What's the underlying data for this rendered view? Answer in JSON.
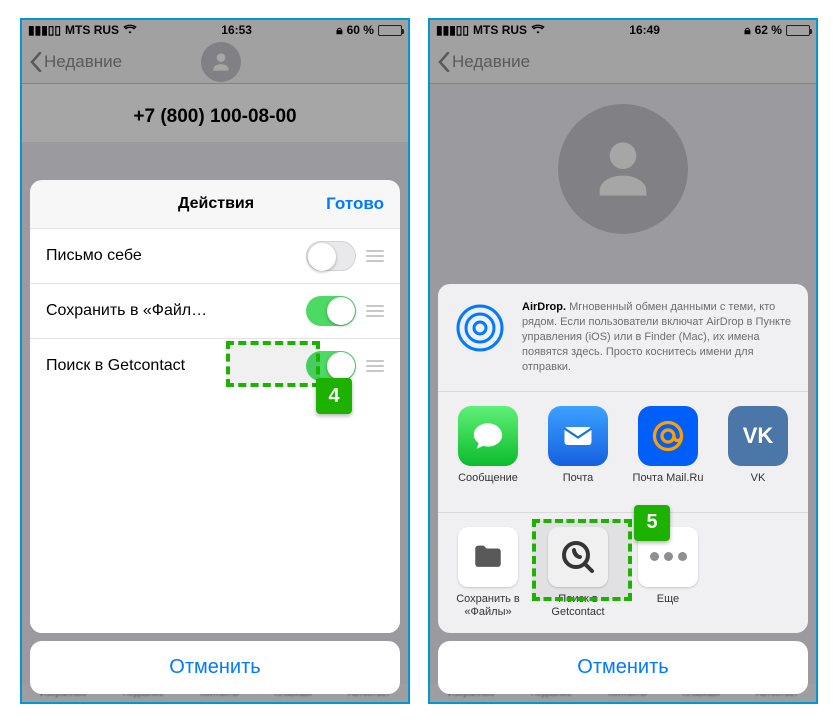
{
  "left": {
    "status": {
      "carrier": "MTS RUS",
      "wifi": true,
      "time": "16:53",
      "lock": true,
      "battery_pct": "60 %",
      "battery_fill": 60
    },
    "nav_back": "Недавние",
    "phone_number": "+7 (800) 100-08-00",
    "sheet": {
      "title": "Действия",
      "done": "Готово",
      "rows": [
        {
          "label": "Письмо себе",
          "on": false
        },
        {
          "label": "Сохранить в «Файл…",
          "on": true
        },
        {
          "label": "Поиск в Getcontact",
          "on": true,
          "highlighted": true
        }
      ],
      "badge": "4",
      "cancel": "Отменить"
    },
    "tabbar": [
      "Избранные",
      "Недавние",
      "Контакты",
      "Клавиши",
      "Автоответ"
    ]
  },
  "right": {
    "status": {
      "carrier": "MTS RUS",
      "wifi": true,
      "time": "16:49",
      "lock": true,
      "battery_pct": "62 %",
      "battery_fill": 62
    },
    "nav_back": "Недавние",
    "airdrop": {
      "title": "AirDrop.",
      "body": "Мгновенный обмен данными с теми, кто рядом. Если пользователи включат AirDrop в Пункте управления (iOS) или в Finder (Mac), их имена появятся здесь. Просто коснитесь имени для отправки."
    },
    "apps": [
      {
        "label": "Сообщение",
        "bg": "#4cd964",
        "icon": "message"
      },
      {
        "label": "Почта",
        "bg": "#1a6fe8",
        "icon": "mail"
      },
      {
        "label": "Почта Mail.Ru",
        "bg": "#ffb300",
        "icon": "mailru"
      },
      {
        "label": "VK",
        "bg": "#4a76a8",
        "icon": "vk"
      }
    ],
    "actions": [
      {
        "label": "Сохранить в «Файлы»",
        "icon": "folder"
      },
      {
        "label": "Поиск в Getcontact",
        "icon": "getcontact",
        "highlighted": true
      },
      {
        "label": "Еще",
        "icon": "more"
      }
    ],
    "badge": "5",
    "cancel": "Отменить",
    "tabbar": [
      "Избранные",
      "Недавние",
      "Контакты",
      "Клавиши",
      "Автоответ"
    ]
  }
}
